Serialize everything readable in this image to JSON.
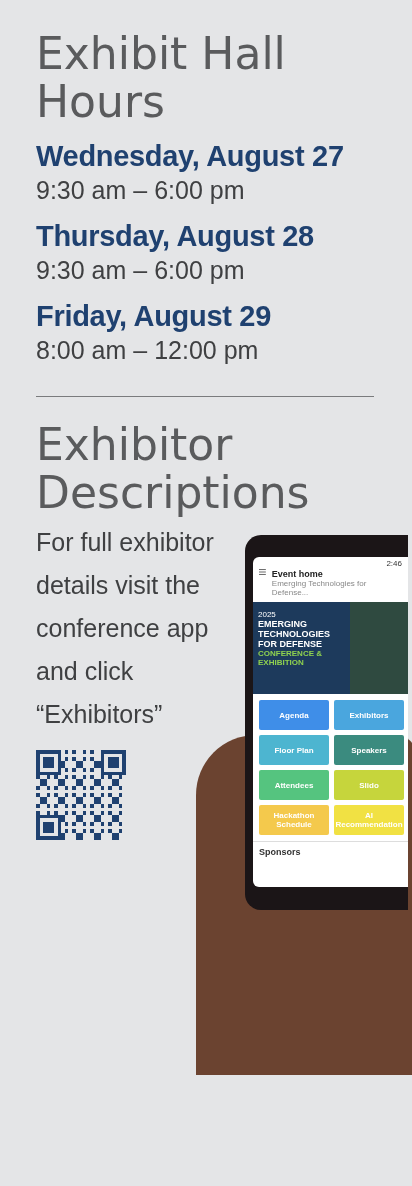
{
  "hours": {
    "title": "Exhibit Hall Hours",
    "days": [
      {
        "day": "Wednesday, August 27",
        "time": "9:30 am – 6:00 pm"
      },
      {
        "day": "Thursday, August 28",
        "time": "9:30 am – 6:00 pm"
      },
      {
        "day": "Friday, August 29",
        "time": "8:00 am – 12:00 pm"
      }
    ]
  },
  "descriptions": {
    "title": "Exhibitor Descriptions",
    "text": "For full exhibitor details visit the conference app and click “Exhibitors”"
  },
  "phone": {
    "status_time": "2:46",
    "header_title": "Event home",
    "header_subtitle": "Emerging Technologies for Defense...",
    "banner": {
      "year": "2025",
      "title": "EMERGING TECHNOLOGIES FOR DEFENSE",
      "subtitle": "CONFERENCE & EXHIBITION"
    },
    "tiles": [
      {
        "label": "Agenda",
        "color": "#3f8ee8"
      },
      {
        "label": "Exhibitors",
        "color": "#4aa6de"
      },
      {
        "label": "Floor Plan",
        "color": "#4db5d0"
      },
      {
        "label": "Speakers",
        "color": "#3b8b7f"
      },
      {
        "label": "Attendees",
        "color": "#55c47f"
      },
      {
        "label": "Slido",
        "color": "#c6d53c"
      },
      {
        "label": "Hackathon Schedule",
        "color": "#f4c94c"
      },
      {
        "label": "AI Recommendation",
        "color": "#f1e143"
      }
    ],
    "section": "Sponsors"
  }
}
